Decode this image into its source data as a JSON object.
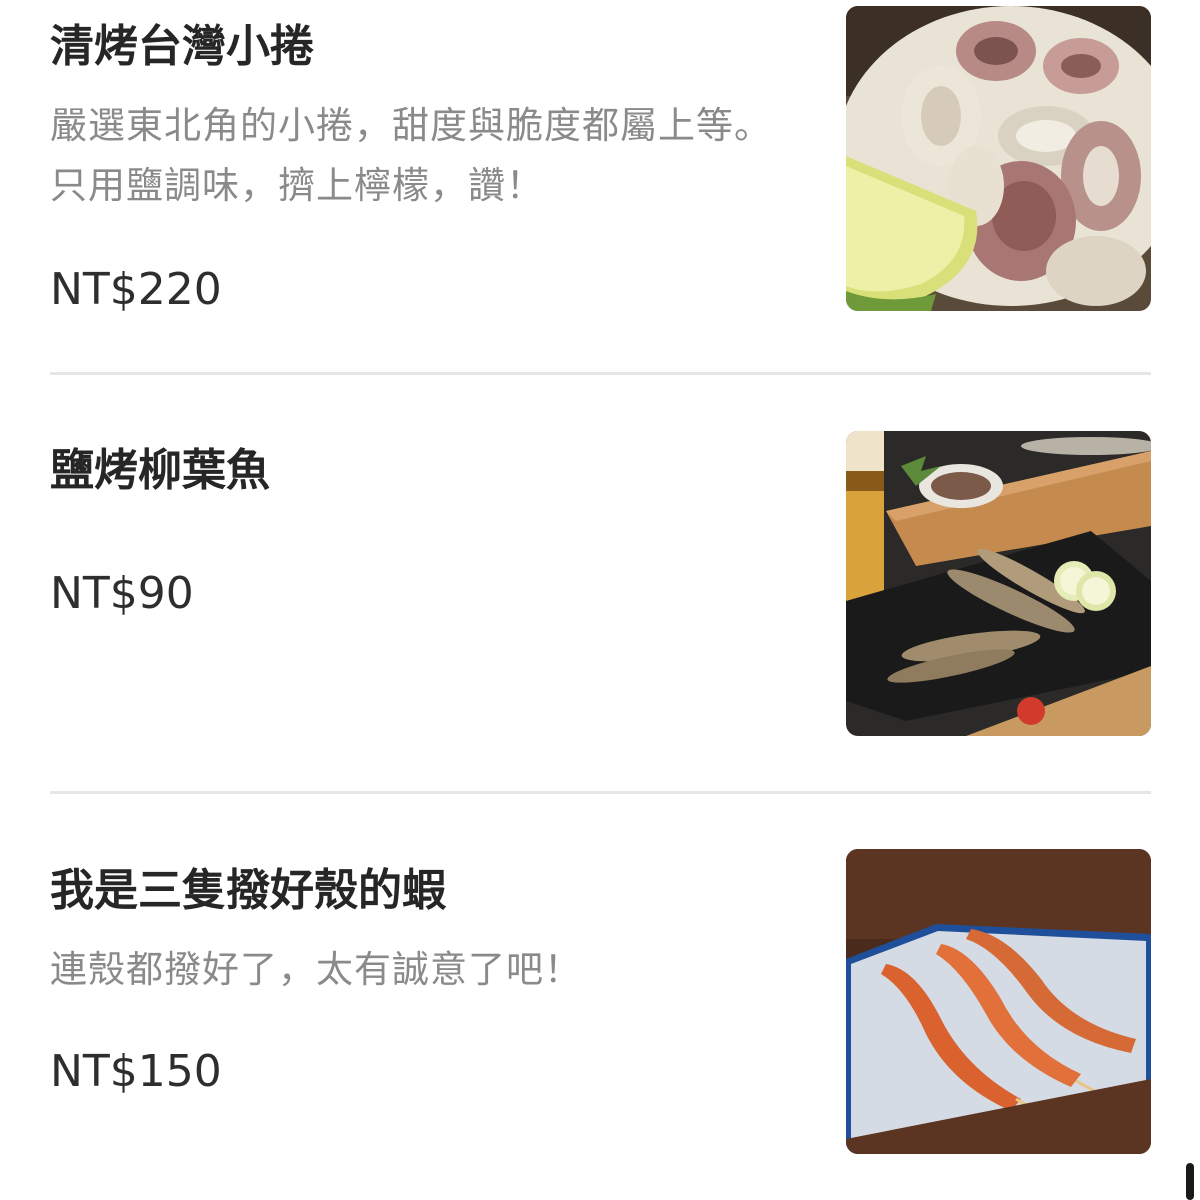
{
  "menu": {
    "items": [
      {
        "name": "清烤台灣小捲",
        "description": "嚴選東北角的小捲，甜度與脆度都屬上等。只用鹽調味，擠上檸檬，讚！",
        "price": "NT$220",
        "image": "grilled-squid-with-lemon"
      },
      {
        "name": "鹽烤柳葉魚",
        "description": "",
        "price": "NT$90",
        "image": "salt-grilled-shishamo-with-beer"
      },
      {
        "name": "我是三隻撥好殼的蝦",
        "description": "連殼都撥好了，太有誠意了吧！",
        "price": "NT$150",
        "image": "three-peeled-grilled-shrimp-skewers"
      }
    ]
  },
  "colors": {
    "title": "#262626",
    "description": "#8a8a8a",
    "price": "#2e2e2e",
    "divider": "#e6e6e6"
  }
}
